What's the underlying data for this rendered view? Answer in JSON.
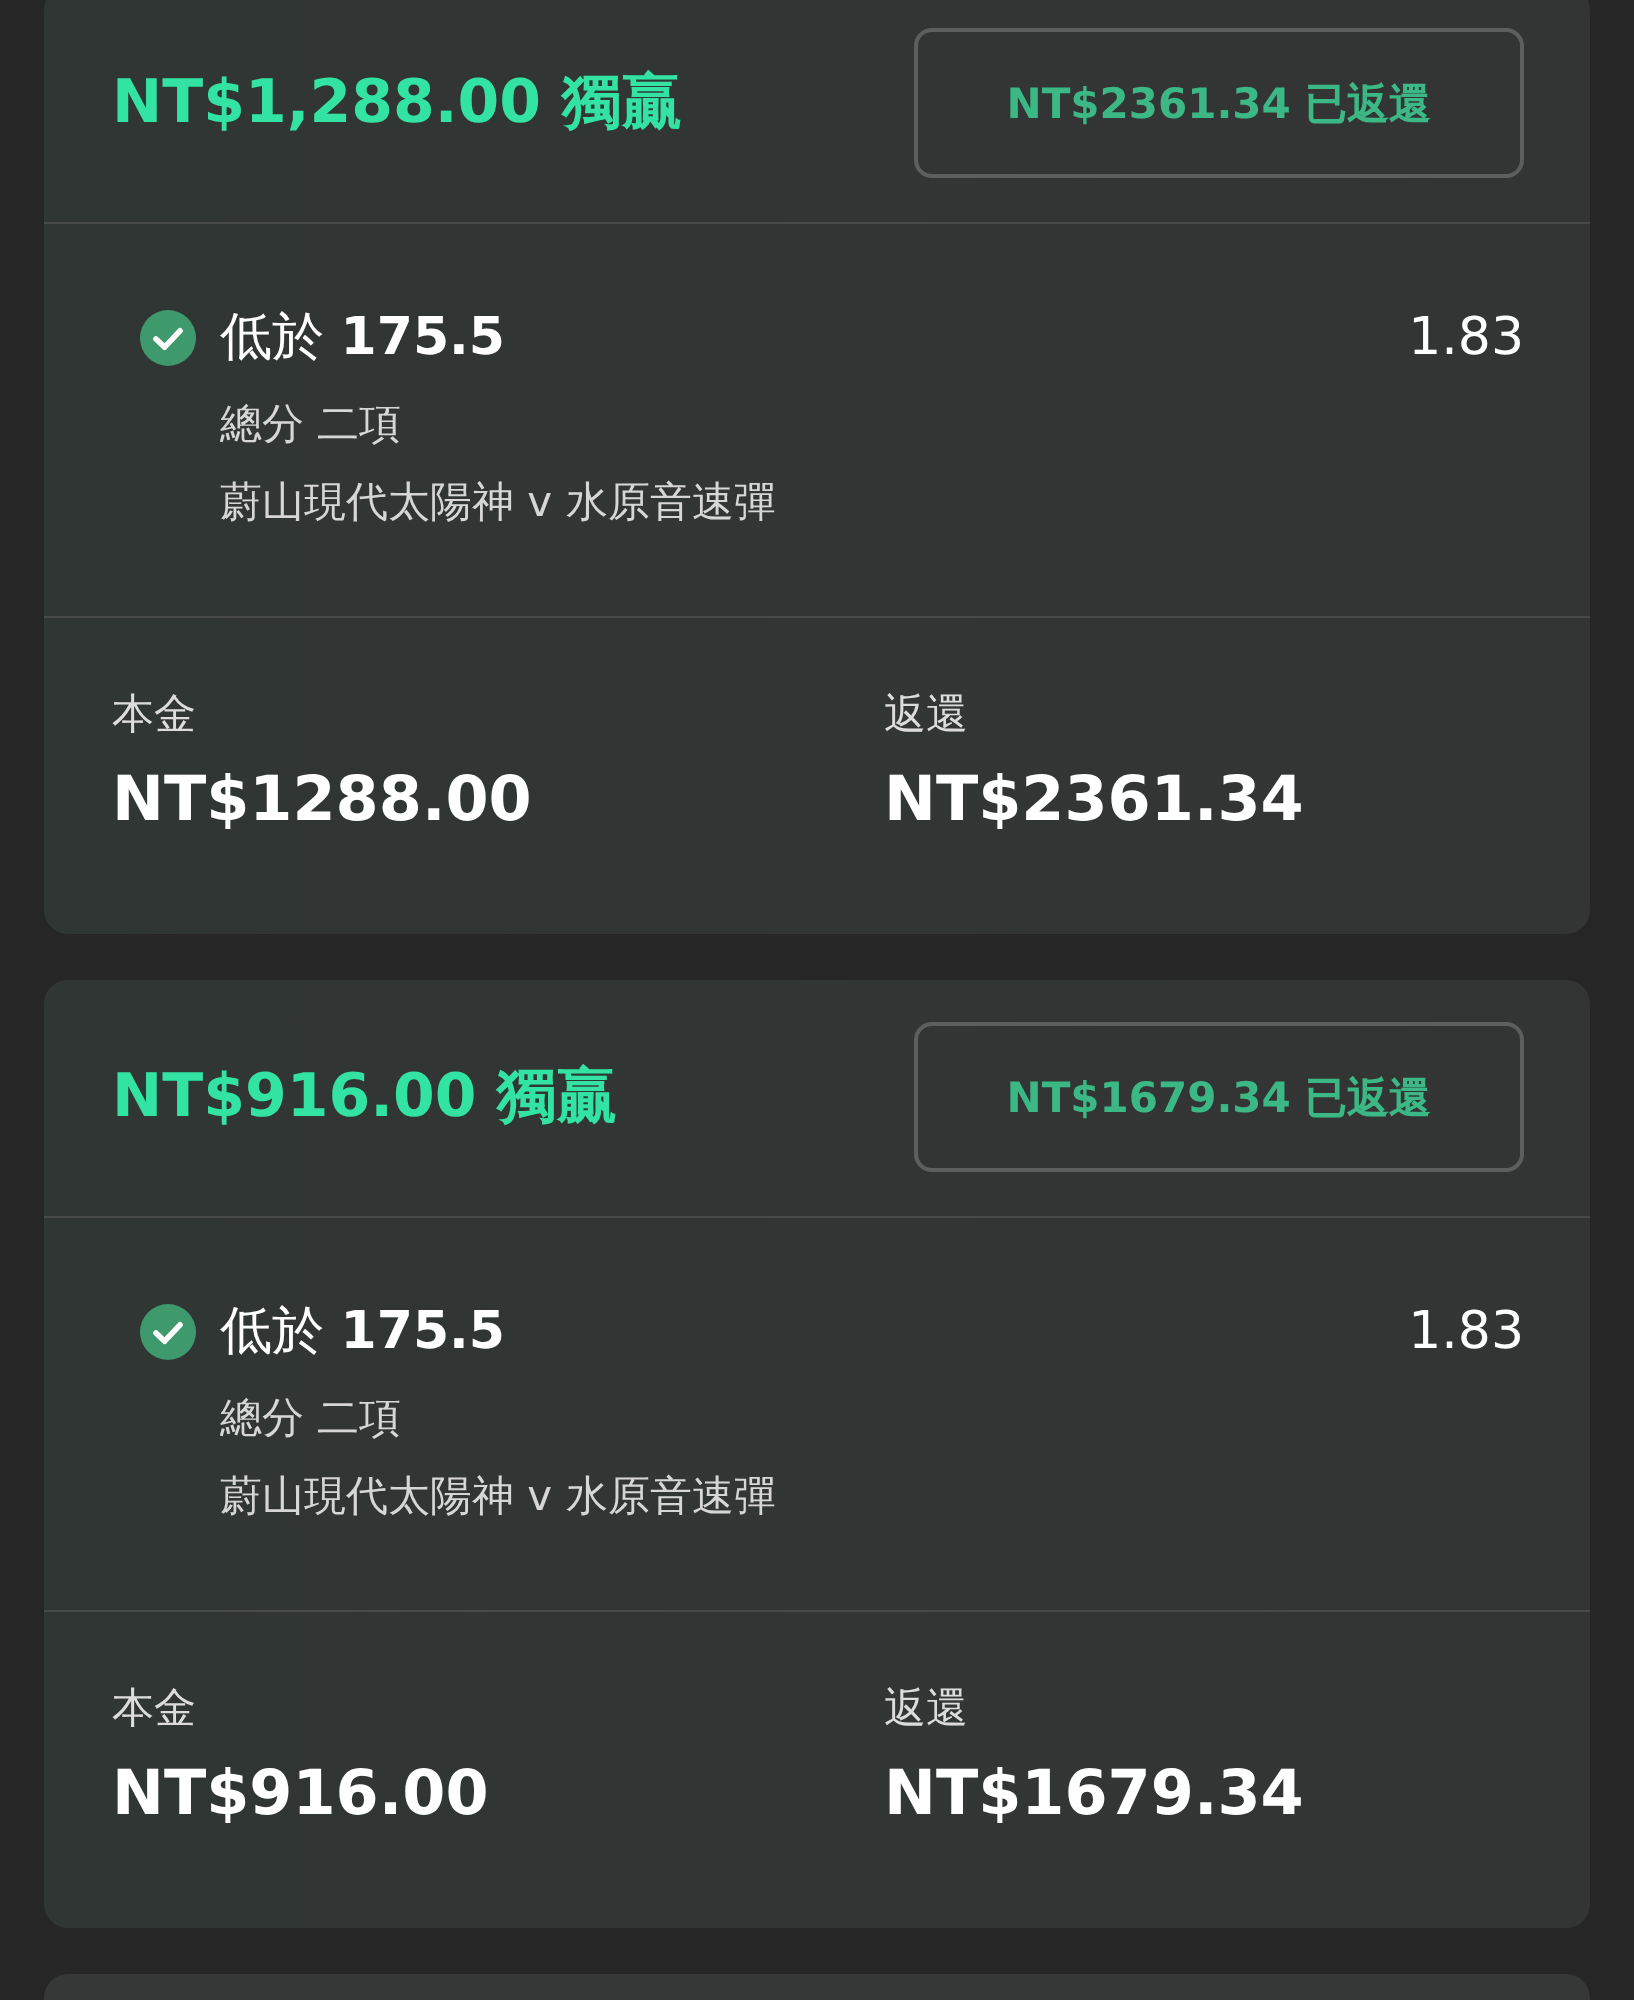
{
  "bets": [
    {
      "title": "NT$1,288.00 獨贏",
      "returned_button": "NT$2361.34 已返還",
      "selections": [
        {
          "won": true,
          "pick": "低於 **175.5**",
          "odds": "1.83",
          "market": "總分 二項",
          "event": "蔚山現代太陽神 v 水原音速彈"
        }
      ],
      "summary": [
        {
          "label": "本金",
          "value": "NT$1288.00"
        },
        {
          "label": "返還",
          "value": "NT$2361.34"
        }
      ]
    },
    {
      "title": "NT$916.00 獨贏",
      "returned_button": "NT$1679.34 已返還",
      "selections": [
        {
          "won": true,
          "pick": "低於 **175.5**",
          "odds": "1.83",
          "market": "總分 二項",
          "event": "蔚山現代太陽神 v 水原音速彈"
        }
      ],
      "summary": [
        {
          "label": "本金",
          "value": "NT$916.00"
        },
        {
          "label": "返還",
          "value": "NT$1679.34"
        }
      ]
    }
  ]
}
